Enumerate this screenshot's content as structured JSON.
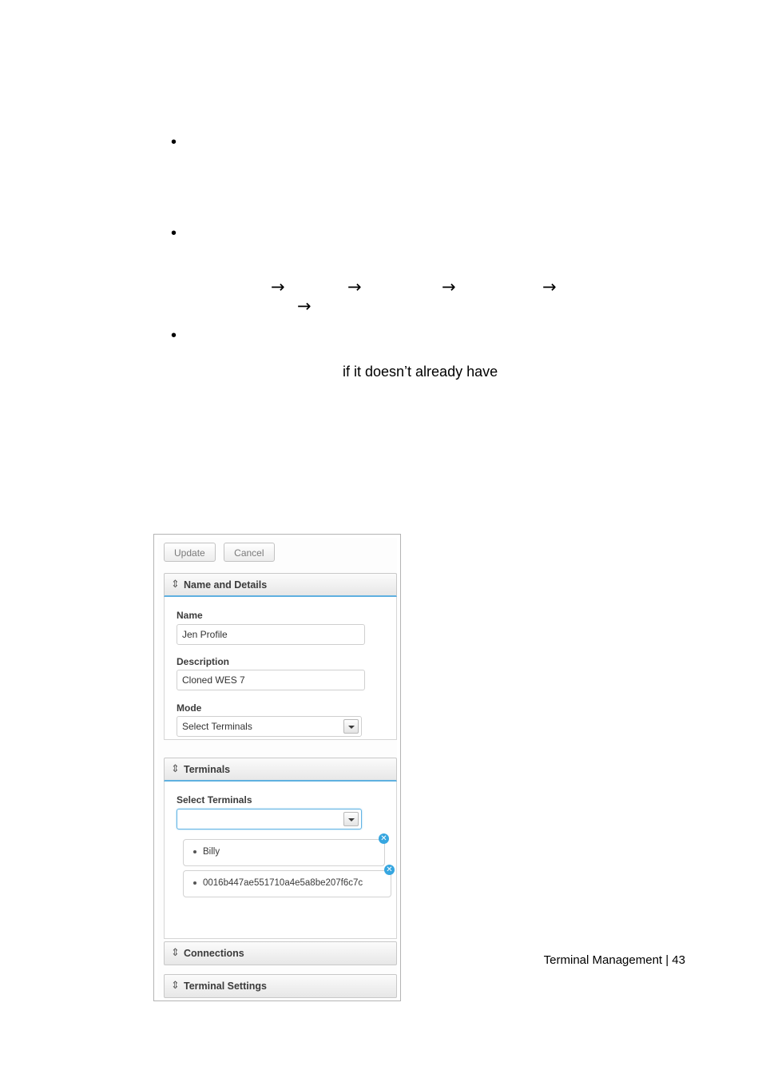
{
  "page": {
    "bullets": [
      "•",
      "•",
      "•"
    ],
    "arrows": [
      "→",
      "→",
      "→",
      "→",
      "→"
    ],
    "inline_text": "if it doesn’t already have",
    "footer": "Terminal Management | 43"
  },
  "figure": {
    "toolbar": {
      "update_label": "Update",
      "cancel_label": "Cancel"
    },
    "sections": [
      {
        "title": "Name and Details",
        "sort_icon": "⇕"
      },
      {
        "title": "Terminals",
        "sort_icon": "⇕"
      },
      {
        "title": "Connections",
        "sort_icon": "⇕"
      },
      {
        "title": "Terminal Settings",
        "sort_icon": "⇕"
      }
    ],
    "name_and_details": {
      "name_label": "Name",
      "name_value": "Jen Profile",
      "description_label": "Description",
      "description_value": "Cloned WES 7",
      "mode_label": "Mode",
      "mode_value": "Select Terminals"
    },
    "terminals": {
      "select_label": "Select Terminals",
      "select_value": "",
      "chips": [
        {
          "label": "Billy",
          "remove_icon": "✕"
        },
        {
          "label": "0016b447ae551710a4e5a8be207f6c7c",
          "remove_icon": "✕"
        }
      ]
    }
  }
}
